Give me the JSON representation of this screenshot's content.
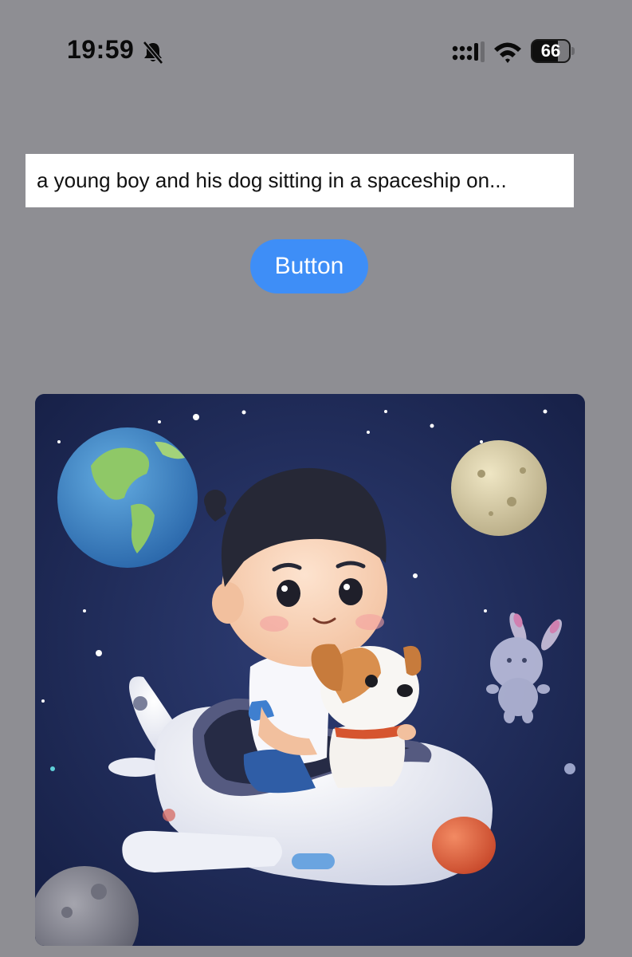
{
  "status_bar": {
    "time": "19:59",
    "battery_level": "66",
    "icons": [
      "bell-slash-icon",
      "cellular-signal-icon",
      "wifi-icon",
      "battery-icon"
    ]
  },
  "prompt": {
    "value": "a young boy and his dog sitting in a spaceship on..."
  },
  "button": {
    "label": "Button",
    "color": "#3e8ef7"
  },
  "colors": {
    "background": "#8e8e93",
    "space": "#1d2a56"
  }
}
